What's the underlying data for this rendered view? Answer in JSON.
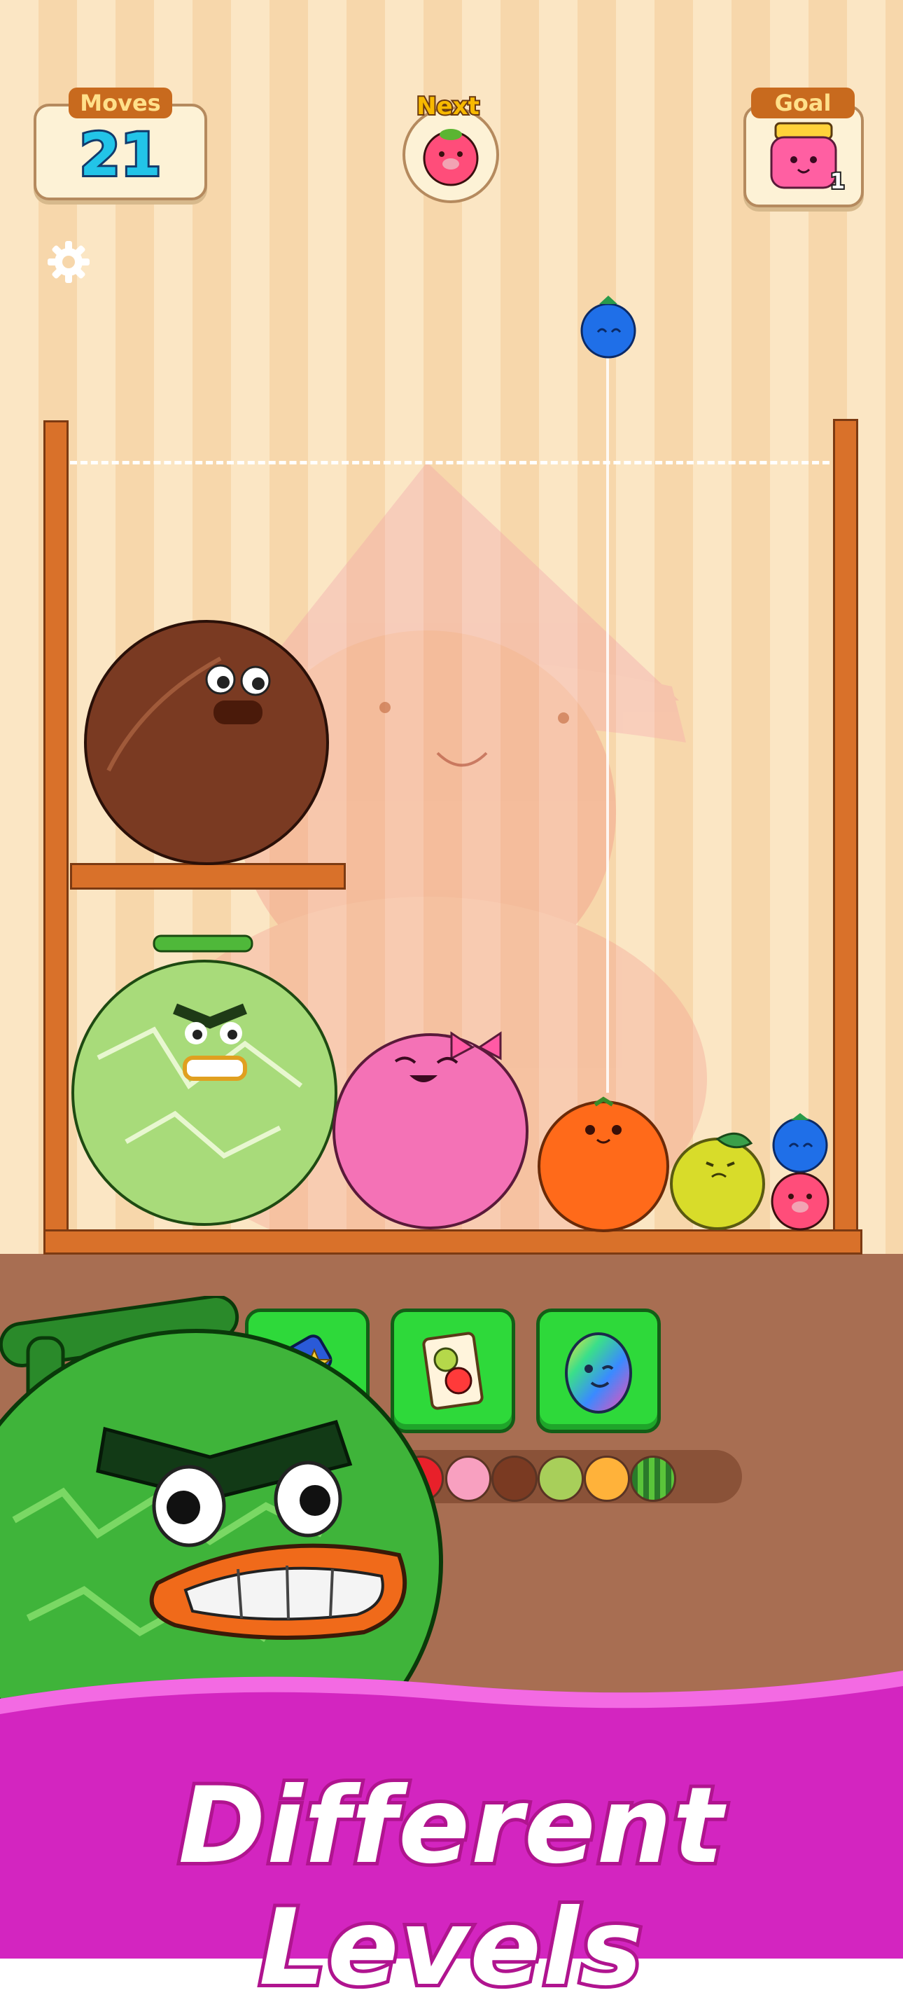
{
  "hud": {
    "moves_label": "Moves",
    "moves_value": "21",
    "next_label": "Next",
    "next_fruit": "strawberry-icon",
    "goal_label": "Goal",
    "goal_item": "jam-jar-icon",
    "goal_count": "1"
  },
  "settings_icon": "gear-icon",
  "dropper_fruit": "blueberry-icon",
  "board_fruits": [
    "coconut",
    "melon",
    "peach",
    "orange",
    "lemon",
    "blueberry",
    "strawberry"
  ],
  "boosters": [
    {
      "name": "hammer-booster",
      "icon": "hammer-icon"
    },
    {
      "name": "swap-booster",
      "icon": "card-icon"
    },
    {
      "name": "rainbow-egg-booster",
      "icon": "rainbow-egg-icon"
    }
  ],
  "evolution_chain": [
    "cherry",
    "strawberry",
    "coconut",
    "kiwi",
    "orange",
    "watermelon"
  ],
  "colors": {
    "moves_value": "#22c4e8",
    "banner": "#d325c0",
    "booster": "#2ed93a",
    "wall": "#d9712a"
  },
  "banner": {
    "title": "Different Levels"
  }
}
